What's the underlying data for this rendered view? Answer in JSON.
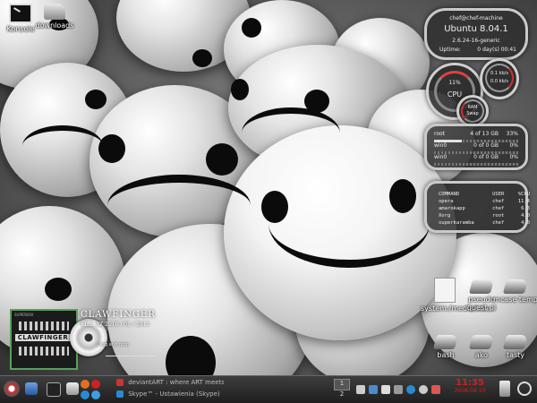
{
  "desktop_icons": [
    {
      "label": "Konsole",
      "icon": "terminal-icon"
    },
    {
      "label": "downloads",
      "icon": "folder-icon"
    }
  ],
  "system_panel": {
    "user_host": "chef@chef-machine",
    "os": "Ubuntu 8.04.1",
    "kernel": "2.6.24-16-generic",
    "uptime_label": "Uptime:",
    "uptime_value": "0 day(s) 00:41"
  },
  "cpu_meter": {
    "value": "11%",
    "label": "CPU",
    "percent": 11
  },
  "net_meter": {
    "down": "0.1 kb/s",
    "up": "0.0 kb/s"
  },
  "mem_meter": {
    "ram_label": "RAM",
    "swap_label": "Swap"
  },
  "disks": [
    {
      "name": "root",
      "usage": "4 of 13 GB",
      "percent_text": "33%",
      "percent": 33
    },
    {
      "name": "win0",
      "usage": "0 of 0 GB",
      "percent_text": "0%",
      "percent": 0
    },
    {
      "name": "win0",
      "usage": "0 of 0 GB",
      "percent_text": "0%",
      "percent": 0
    }
  ],
  "processes": {
    "headers": [
      "COMMAND",
      "USER",
      "%CPU"
    ],
    "rows": [
      [
        "opera",
        "chef",
        "11.4"
      ],
      [
        "amarokapp",
        "chef",
        "6.3"
      ],
      [
        "Xorg",
        "root",
        "4.0"
      ],
      [
        "superkaramba",
        "chef",
        "4.0"
      ]
    ]
  },
  "now_playing": {
    "artist": "CLAWFINGER",
    "album_line": "KILL AZ 2010 / 01 / 2013",
    "cover_text": "CLAWFINGER",
    "cover_top": "SUPERBOX",
    "status": "Drag and drop"
  },
  "right_icons": [
    {
      "label": "system:/media/sda...",
      "icon": "file-icon"
    },
    {
      "label": "pseudo quest pl",
      "icon": "folder-icon"
    },
    {
      "label": "mcase temp",
      "icon": "folder-icon"
    },
    {
      "label": "bash",
      "icon": "folder-icon"
    },
    {
      "label": "ako",
      "icon": "folder-icon"
    },
    {
      "label": "tasty",
      "icon": "folder-icon"
    }
  ],
  "taskbar": {
    "tasks": [
      "deviantART : where ART meets...",
      "Skype™ - Ustawienia (Skype)"
    ],
    "pager": [
      "1",
      "2"
    ],
    "clock_time": "11:35",
    "clock_date": "2008-08-10",
    "accent_color": "#cc2222"
  }
}
